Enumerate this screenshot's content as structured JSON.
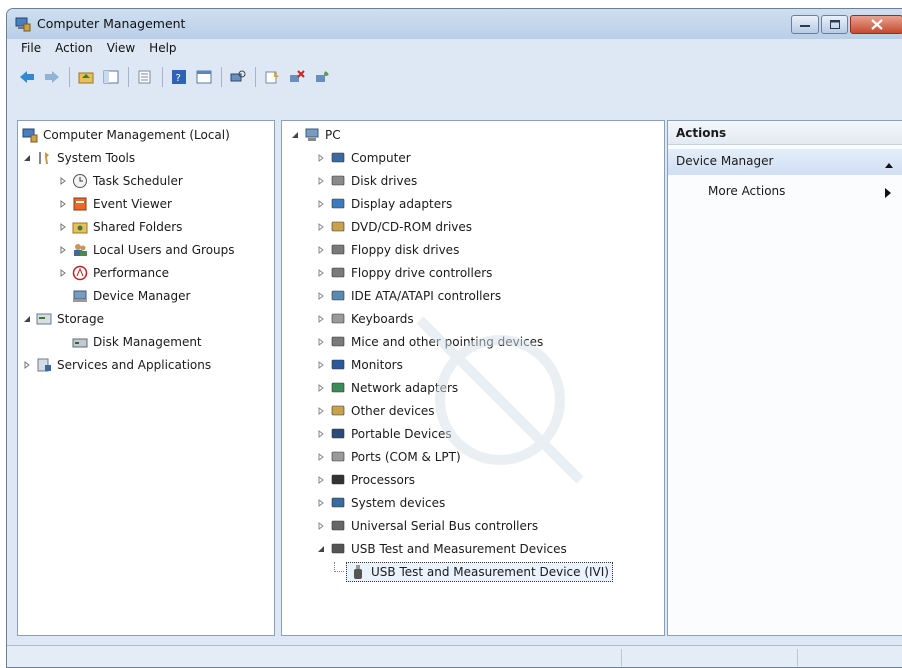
{
  "window": {
    "title": "Computer Management"
  },
  "menu": [
    "File",
    "Action",
    "View",
    "Help"
  ],
  "toolbar": [
    "back-icon",
    "forward-icon",
    "up-folder-icon",
    "show-hide-tree-icon",
    "export-list-icon",
    "help-icon",
    "console-view-icon",
    "scan-hardware-icon",
    "update-driver-icon",
    "uninstall-icon",
    "disable-icon"
  ],
  "left_tree": {
    "root": "Computer Management (Local)",
    "system_tools": "System Tools",
    "task_scheduler": "Task Scheduler",
    "event_viewer": "Event Viewer",
    "shared_folders": "Shared Folders",
    "local_users": "Local Users and Groups",
    "performance": "Performance",
    "device_manager": "Device Manager",
    "storage": "Storage",
    "disk_management": "Disk Management",
    "services": "Services and Applications"
  },
  "device_tree": {
    "root": "PC",
    "items": [
      "Computer",
      "Disk drives",
      "Display adapters",
      "DVD/CD-ROM drives",
      "Floppy disk drives",
      "Floppy drive controllers",
      "IDE ATA/ATAPI controllers",
      "Keyboards",
      "Mice and other pointing devices",
      "Monitors",
      "Network adapters",
      "Other devices",
      "Portable Devices",
      "Ports (COM & LPT)",
      "Processors",
      "System devices",
      "Universal Serial Bus controllers",
      "USB Test and Measurement Devices"
    ],
    "selected_child": "USB Test and Measurement Device (IVI)"
  },
  "actions": {
    "header": "Actions",
    "section": "Device Manager",
    "more": "More Actions"
  },
  "colors": {
    "window_bg": "#dde8f4",
    "close_button": "#c44a2f",
    "selection": "#eaf3fd"
  }
}
